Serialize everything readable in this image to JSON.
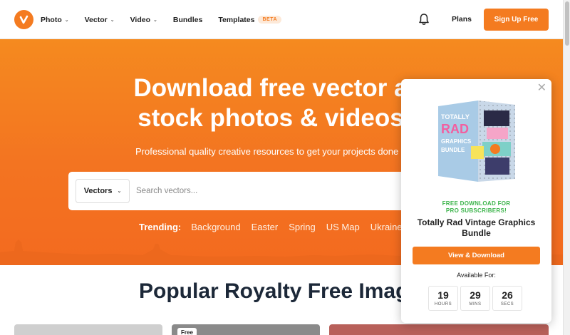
{
  "header": {
    "nav": [
      {
        "label": "Photo",
        "has_dropdown": true
      },
      {
        "label": "Vector",
        "has_dropdown": true
      },
      {
        "label": "Video",
        "has_dropdown": true
      },
      {
        "label": "Bundles",
        "has_dropdown": false
      },
      {
        "label": "Templates",
        "has_dropdown": false,
        "badge": "BETA"
      }
    ],
    "plans_label": "Plans",
    "signup_label": "Sign Up Free",
    "bell_icon": "bell-icon",
    "accent_color": "#f47b20"
  },
  "hero": {
    "title_line1": "Download free vector a",
    "title_line2": "stock photos & videos",
    "subtitle": "Professional quality creative resources to get your projects done",
    "search": {
      "category": "Vectors",
      "placeholder": "Search vectors..."
    },
    "trending": {
      "label": "Trending:",
      "links": [
        "Background",
        "Easter",
        "Spring",
        "US Map",
        "Ukraine"
      ]
    }
  },
  "popular": {
    "title": "Popular Royalty Free Image",
    "badge": "Free"
  },
  "popup": {
    "promo_line1": "FREE DOWNLOAD FOR",
    "promo_line2": "PRO SUBSCRIBERS!",
    "title_line1": "Totally Rad Vintage Graphics",
    "title_line2": "Bundle",
    "button_label": "View & Download",
    "available_label": "Available For:",
    "timer": [
      {
        "value": "19",
        "unit": "HOURS"
      },
      {
        "value": "29",
        "unit": "MINS"
      },
      {
        "value": "26",
        "unit": "SECS"
      }
    ],
    "box_art": {
      "line1": "TOTALLY",
      "line2": "RAD",
      "line3": "GRAPHICS",
      "line4": "BUNDLE"
    },
    "promo_color": "#3cb44b"
  }
}
